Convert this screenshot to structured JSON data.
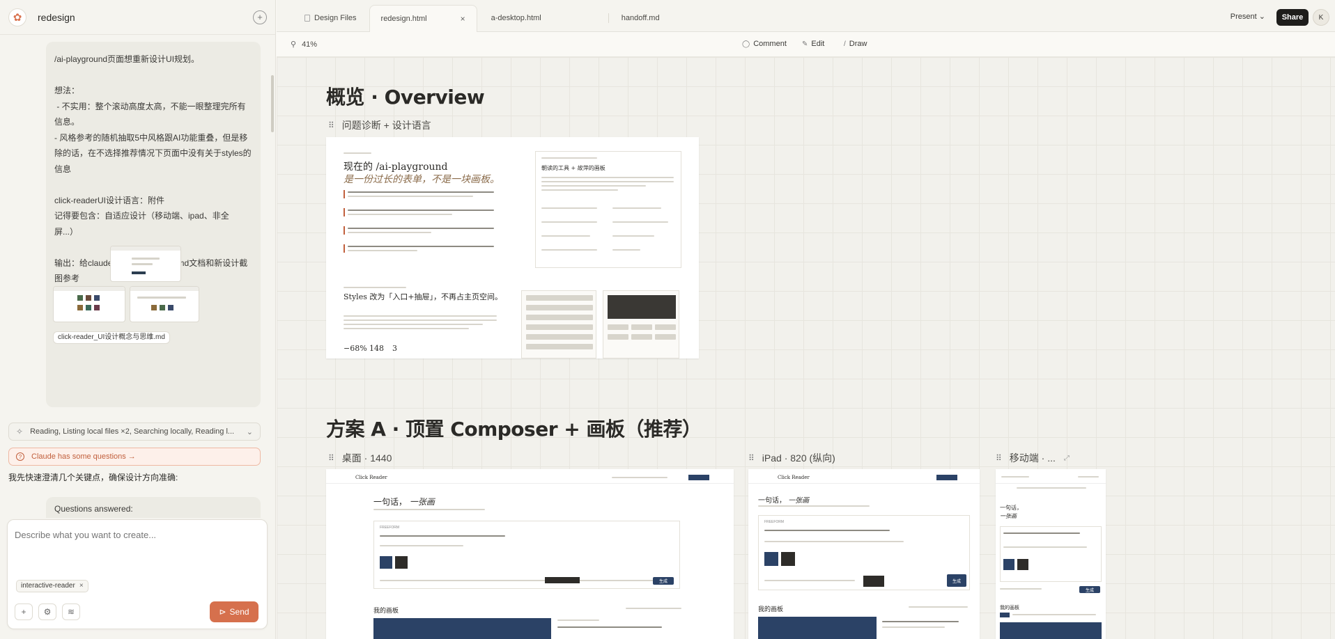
{
  "sidebar": {
    "project_name": "redesign",
    "user_message": "/ai-playground页面想重新设计UI规划。\n\n想法：\n - 不实用：整个滚动高度太高，不能一眼整理完所有信息。\n- 风格参考的随机抽取5中风格跟AI功能重叠，但是移除的话，在不选择推荐情况下页面中没有关于styles的信息\n\nclick-readerUI设计语言：附件\n记得要包含：自适应设计（移动端、ipad、非全屏...）\n\n输出：给claude code的handoff，md文档和新设计截图参考",
    "attachment_chip_1": "interactive-reader",
    "attachment_chip_2": "click-reader_UI设计概念与思维.md",
    "activity_summary": "Reading, Listing local files ×2, Searching locally, Reading l...",
    "questions_banner": "Claude has some questions →",
    "assistant_text": "我先快速澄清几个关键点，确保设计方向准确:",
    "questions_answered": "Questions answered:",
    "composer_placeholder": "Describe what you want to create...",
    "composer_chip": "interactive-reader",
    "send_label": "Send"
  },
  "tabs": [
    {
      "label": "Design Files",
      "active": false
    },
    {
      "label": "redesign.html",
      "active": true
    },
    {
      "label": "a-desktop.html",
      "active": false
    },
    {
      "label": "handoff.md",
      "active": false
    }
  ],
  "header": {
    "present_label": "Present",
    "share_label": "Share",
    "avatar_initial": "K"
  },
  "toolbar": {
    "zoom": "41%",
    "comment_label": "Comment",
    "edit_label": "Edit",
    "draw_label": "Draw"
  },
  "canvas": {
    "overview_title": "概览 · Overview",
    "overview_frame_label": "问题诊断 + 设计语言",
    "overview_board": {
      "headline_1": "现在的 /ai-playground",
      "headline_2": "是一份过长的表单，不是一块画板。",
      "panel_title": "朝读的工具 + 故萍的画板",
      "styles_title": "Styles 改为「入口+抽屉」，不再占主页空间。",
      "stat_1": "−68%",
      "stat_2": "148",
      "stat_3": "3"
    },
    "plan_a_title": "方案 A · 顶置 Composer + 画板（推荐）",
    "desktop_label": "桌面 · 1440",
    "ipad_label": "iPad · 820 (纵向)",
    "mobile_label": "移动端 · ...",
    "board_brand": "Click Reader",
    "board_hero_1": "一句话，",
    "board_hero_2": "一张画",
    "board_gallery": "我的画板",
    "board_freeform": "FREEFORM",
    "board_generate": "生成"
  },
  "colors": {
    "accent": "#d6704d",
    "navy": "#2b4266",
    "share_bg": "#1e1d1b"
  }
}
